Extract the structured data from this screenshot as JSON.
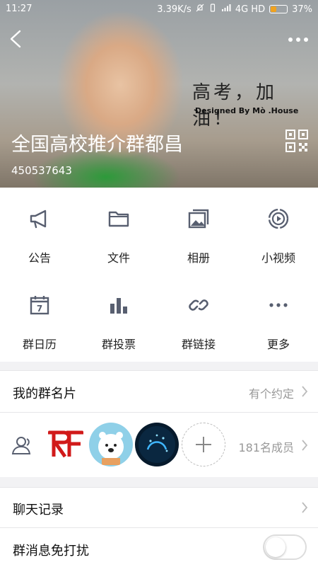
{
  "status": {
    "time": "11:27",
    "speed": "3.39K/s",
    "network": "4G HD",
    "battery": "37%",
    "battery_level": 0.37
  },
  "header": {
    "slogan": "高考，加油！",
    "designed": "Designed By Mò .House",
    "group_name": "全国高校推介群都昌",
    "group_id": "450537643"
  },
  "actions": [
    {
      "label": "公告",
      "icon": "megaphone-icon"
    },
    {
      "label": "文件",
      "icon": "folder-icon"
    },
    {
      "label": "相册",
      "icon": "album-icon"
    },
    {
      "label": "小视频",
      "icon": "video-icon"
    },
    {
      "label": "群日历",
      "icon": "calendar-icon",
      "day": "7"
    },
    {
      "label": "群投票",
      "icon": "bar-chart-icon"
    },
    {
      "label": "群链接",
      "icon": "link-icon"
    },
    {
      "label": "更多",
      "icon": "more-icon"
    }
  ],
  "card": {
    "title": "我的群名片",
    "value": "有个约定"
  },
  "members": {
    "count_label": "181名成员"
  },
  "chat_history": {
    "title": "聊天记录"
  },
  "dnd": {
    "title": "群消息免打扰",
    "enabled": false
  },
  "colors": {
    "icon_gray": "#585f70",
    "battery_orange": "#f0a21f",
    "toggle_border": "#dddddd"
  }
}
